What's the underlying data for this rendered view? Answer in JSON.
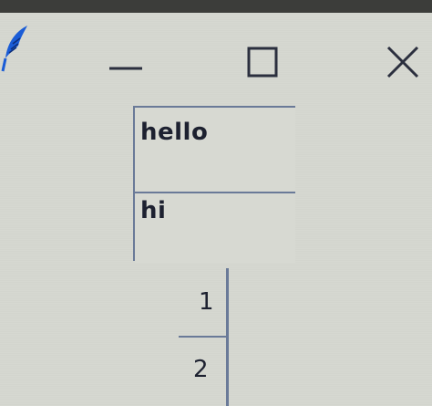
{
  "titlebar": {
    "app_icon": "feather-icon",
    "minimize_icon": "minimize-icon",
    "maximize_icon": "maximize-icon",
    "close_icon": "close-icon"
  },
  "fields": {
    "first_value": "hello",
    "second_value": "hi"
  },
  "stepper": {
    "value_1": "1",
    "value_2": "2"
  },
  "colors": {
    "background": "#d4d6cf",
    "border": "#6a7a98",
    "text": "#1d2130",
    "icon_blue": "#1a5cd6"
  }
}
